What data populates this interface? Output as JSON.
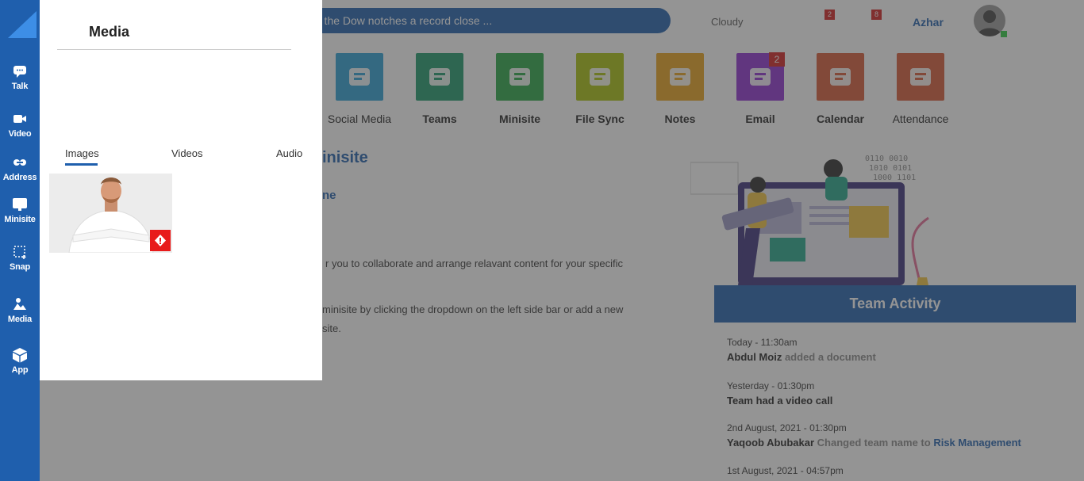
{
  "sidebar": {
    "items": [
      {
        "label": "Talk",
        "icon": "chat-icon"
      },
      {
        "label": "Video",
        "icon": "video-icon"
      },
      {
        "label": "Address",
        "icon": "address-icon"
      },
      {
        "label": "Minisite",
        "icon": "minisite-icon"
      },
      {
        "label": "Snap",
        "icon": "snap-icon"
      },
      {
        "label": "Media",
        "icon": "media-icon"
      },
      {
        "label": "App",
        "icon": "app-icon"
      }
    ]
  },
  "header": {
    "ticker": "r the Dow notches a record close ...",
    "weather": "Cloudy",
    "notif_badges": [
      "2",
      "8"
    ],
    "username": "Azhar"
  },
  "apps": [
    {
      "label": "Social Media",
      "color": "#2b9fd4",
      "bold": false
    },
    {
      "label": "Teams",
      "color": "#1e9a6c",
      "bold": true
    },
    {
      "label": "Minisite",
      "color": "#28a745",
      "bold": true
    },
    {
      "label": "File Sync",
      "color": "#a8c20c",
      "bold": true
    },
    {
      "label": "Notes",
      "color": "#e8a21c",
      "bold": true
    },
    {
      "label": "Email",
      "color": "#8e2fd0",
      "bold": true,
      "badge": "2"
    },
    {
      "label": "Calendar",
      "color": "#d85a35",
      "bold": true
    },
    {
      "label": "Attendance",
      "color": "#d85a35",
      "bold": false
    }
  ],
  "welcome": {
    "title": "inisite",
    "subtitle": "ne",
    "p1": "r you to collaborate and arrange relavant content for your specific",
    "p2": "minisite by clicking the dropdown on the left side bar or add a new",
    "p3": "site."
  },
  "team_activity": {
    "title": "Team Activity",
    "entries": [
      {
        "time": "Today - 11:30am",
        "actor": "Abdul Moiz",
        "action": "added a document",
        "target": ""
      },
      {
        "time": "Yesterday - 01:30pm",
        "actor": "Team had a video call",
        "action": "",
        "target": ""
      },
      {
        "time": "2nd August, 2021 - 01:30pm",
        "actor": "Yaqoob Abubakar",
        "action": "Changed team name to",
        "target": "Risk Management"
      },
      {
        "time": "1st August, 2021 - 04:57pm",
        "actor": "",
        "action": "",
        "target": ""
      }
    ]
  },
  "media_panel": {
    "title": "Media",
    "tabs": [
      "Images",
      "Videos",
      "Audio"
    ],
    "active_tab": "Images"
  }
}
